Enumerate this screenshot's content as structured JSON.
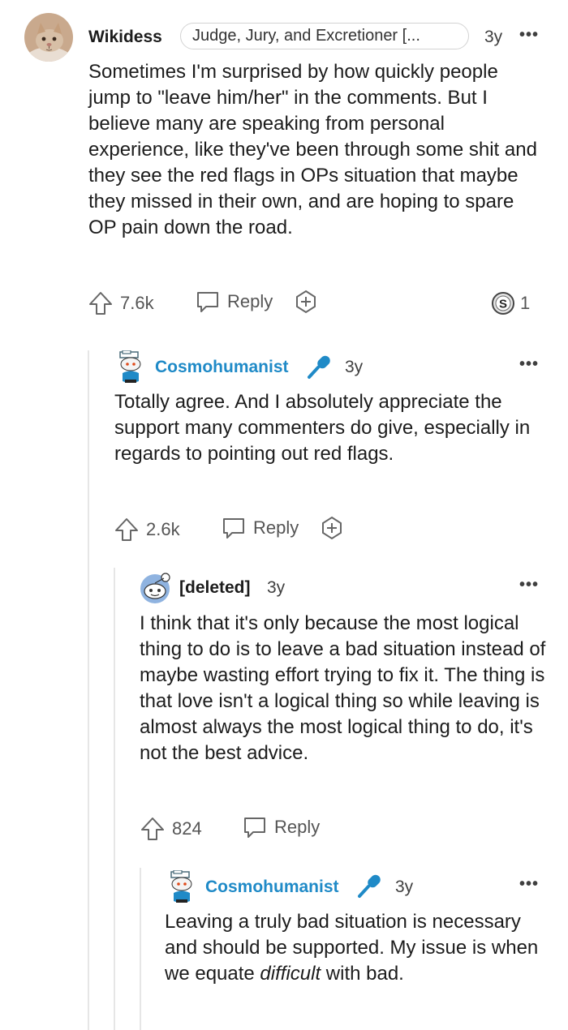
{
  "comments": [
    {
      "username": "Wikidess",
      "flair": "Judge, Jury, and Excretioner [...",
      "age": "3y",
      "more": "•••",
      "body": "Sometimes I'm surprised by how quickly people jump to \"leave him/her\" in the comments. But I believe many are speaking from personal experience, like they've been through some shit and they see the red flags in OPs situation that maybe they missed in their own, and are hoping to spare OP pain down the road.",
      "votes": "7.6k",
      "reply_label": "Reply",
      "award_count": "1"
    },
    {
      "username": "Cosmohumanist",
      "age": "3y",
      "more": "•••",
      "body": "Totally agree. And I absolutely appreciate the support many commenters do give, especially in regards to pointing out red flags.",
      "votes": "2.6k",
      "reply_label": "Reply"
    },
    {
      "username": "[deleted]",
      "age": "3y",
      "more": "•••",
      "body": "I think that it's only because the most logical thing to do is to leave a bad situation instead of maybe wasting effort trying to fix it. The thing is that love isn't a logical thing so while leaving is almost always the most logical thing to do, it's not the best advice.",
      "votes": "824",
      "reply_label": "Reply"
    },
    {
      "username": "Cosmohumanist",
      "age": "3y",
      "more": "•••",
      "body_before": "Leaving a truly bad situation is necessary and should be supported. My issue is when we equate ",
      "body_emph": "difficult",
      "body_after": " with bad."
    }
  ],
  "colors": {
    "op_username": "#1c1c1c",
    "reply_username": "#1f8ac7",
    "mic_icon": "#1f8ac7",
    "thread_line": "#e6e6e6"
  }
}
